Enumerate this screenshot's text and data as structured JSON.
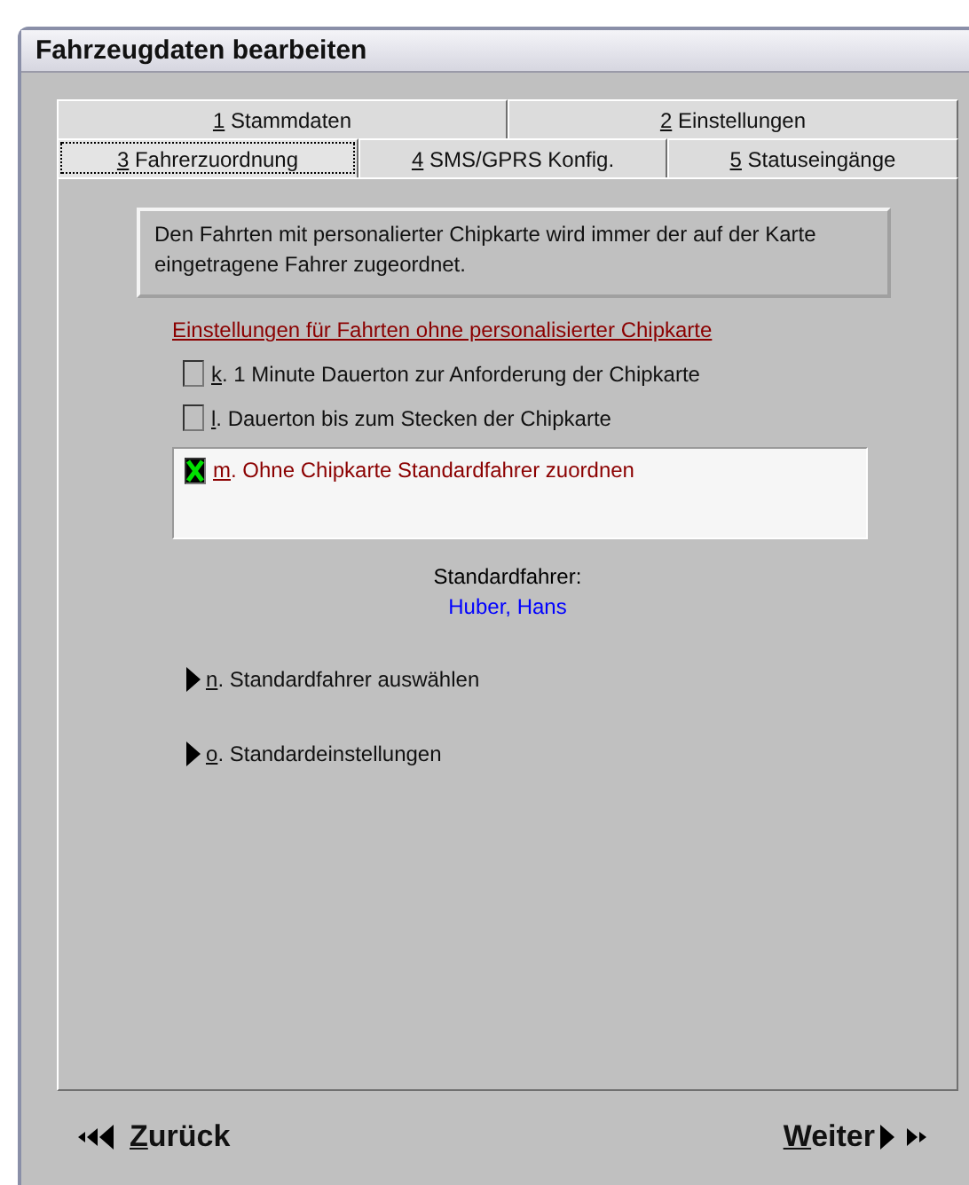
{
  "window": {
    "title": "Fahrzeugdaten bearbeiten"
  },
  "tab_rows": [
    [
      {
        "key": "1",
        "label": " Stammdaten",
        "selected": false
      },
      {
        "key": "2",
        "label": " Einstellungen",
        "selected": false
      }
    ],
    [
      {
        "key": "3",
        "label": " Fahrerzuordnung",
        "selected": true
      },
      {
        "key": "4",
        "label": " SMS/GPRS Konfig.",
        "selected": false
      },
      {
        "key": "5",
        "label": " Statuseingänge",
        "selected": false
      }
    ]
  ],
  "info": "Den Fahrten mit personalierter Chipkarte wird immer der auf der Karte eingetragene Fahrer zugeordnet.",
  "section_link": "Einstellungen für Fahrten ohne personalisierter Chipkarte",
  "options": [
    {
      "key": "k",
      "label": ". 1 Minute Dauerton zur Anforderung der Chipkarte",
      "checked": false
    },
    {
      "key": "l",
      "label": ". Dauerton bis zum Stecken der Chipkarte",
      "checked": false
    },
    {
      "key": "m",
      "label": ". Ohne Chipkarte Standardfahrer zuordnen",
      "checked": true
    }
  ],
  "default_driver": {
    "label": "Standardfahrer:",
    "name": "Huber, Hans"
  },
  "actions": [
    {
      "key": "n",
      "label": ". Standardfahrer auswählen"
    },
    {
      "key": "o",
      "label": ". Standardeinstellungen"
    }
  ],
  "nav": {
    "back": {
      "key": "Z",
      "label": "urück"
    },
    "next": {
      "key": "W",
      "label": "eiter"
    }
  }
}
